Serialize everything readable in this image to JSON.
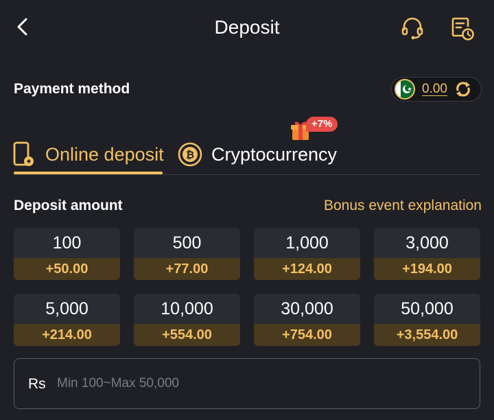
{
  "header": {
    "title": "Deposit",
    "icons": [
      "chevron-left-icon",
      "headset-icon",
      "history-icon"
    ]
  },
  "payment": {
    "label": "Payment method",
    "balance": "0.00",
    "flag_icon": "pakistan-flag-icon",
    "refresh_icon": "refresh-icon"
  },
  "tabs": [
    {
      "label": "Online deposit",
      "icon": "phone-deposit-icon",
      "active": true
    },
    {
      "label": "Cryptocurrency",
      "icon": "bitcoin-icon",
      "active": false,
      "badge": "+7%"
    }
  ],
  "deposit": {
    "label": "Deposit amount",
    "bonus_link": "Bonus event explanation",
    "options": [
      {
        "amount": "100",
        "bonus": "+50.00"
      },
      {
        "amount": "500",
        "bonus": "+77.00"
      },
      {
        "amount": "1,000",
        "bonus": "+124.00"
      },
      {
        "amount": "3,000",
        "bonus": "+194.00"
      },
      {
        "amount": "5,000",
        "bonus": "+214.00"
      },
      {
        "amount": "10,000",
        "bonus": "+554.00"
      },
      {
        "amount": "30,000",
        "bonus": "+754.00"
      },
      {
        "amount": "50,000",
        "bonus": "+3,554.00"
      }
    ]
  },
  "amount_input": {
    "currency": "Rs",
    "placeholder": "Min 100~Max 50,000",
    "value": ""
  },
  "colors": {
    "background": "#1f2026",
    "accent": "#f2c063",
    "card": "#2a2c33",
    "bonus_band": "#4a3a1e",
    "promo_badge": "#e64b45"
  }
}
